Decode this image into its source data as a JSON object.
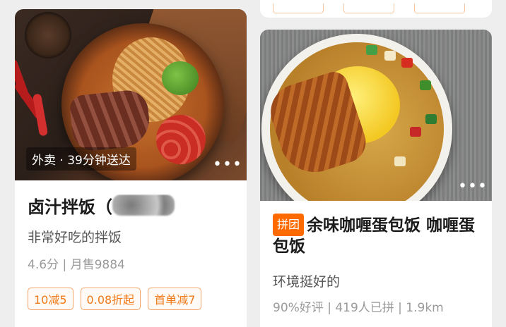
{
  "cards": [
    {
      "overlay_label": "外卖 · 39分钟送达",
      "more_icon": "•••",
      "title": "卤汁拌饭（",
      "description": "非常好吃的拌饭",
      "meta": "4.6分 | 月售9884",
      "chips": [
        "10减5",
        "0.08折起",
        "首单减7"
      ]
    },
    {
      "more_icon": "•••",
      "tag": "拼团",
      "title": "余味咖喱蛋包饭 咖喱蛋包饭",
      "description": "环境挺好的",
      "meta": "90%好评 | 419人已拼 | 1.9km"
    }
  ],
  "colors": {
    "accent": "#ff6a00",
    "chip_border": "#f2a46c",
    "chip_text": "#f07a1a",
    "background": "#eeeeee"
  },
  "icons": [
    "more-dots-icon"
  ]
}
